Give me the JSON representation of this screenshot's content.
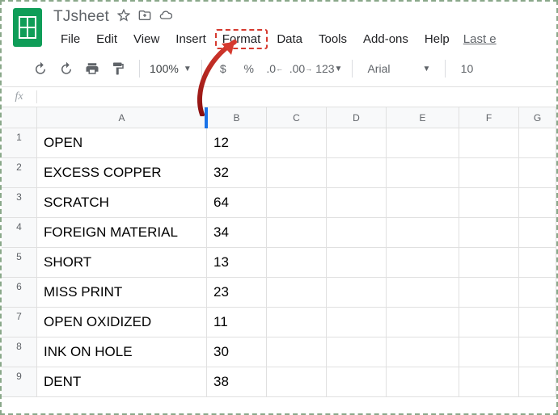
{
  "doc": {
    "title": "TJsheet"
  },
  "menu": {
    "file": "File",
    "edit": "Edit",
    "view": "View",
    "insert": "Insert",
    "format": "Format",
    "data": "Data",
    "tools": "Tools",
    "addons": "Add-ons",
    "help": "Help",
    "last_edit": "Last e"
  },
  "toolbar": {
    "zoom": "100%",
    "currency": "$",
    "percent": "%",
    "dec_dec": ".0",
    "inc_dec": ".00",
    "more_formats": "123",
    "font": "Arial",
    "font_size": "10"
  },
  "fx": {
    "label": "fx"
  },
  "columns": [
    "A",
    "B",
    "C",
    "D",
    "E",
    "F",
    "G"
  ],
  "rows": [
    {
      "n": "1",
      "a": "OPEN",
      "b": "12"
    },
    {
      "n": "2",
      "a": "EXCESS COPPER",
      "b": "32"
    },
    {
      "n": "3",
      "a": "SCRATCH",
      "b": "64"
    },
    {
      "n": "4",
      "a": "FOREIGN MATERIAL",
      "b": "34"
    },
    {
      "n": "5",
      "a": "SHORT",
      "b": "13"
    },
    {
      "n": "6",
      "a": "MISS PRINT",
      "b": "23"
    },
    {
      "n": "7",
      "a": "OPEN OXIDIZED",
      "b": "11"
    },
    {
      "n": "8",
      "a": "INK ON HOLE",
      "b": "30"
    },
    {
      "n": "9",
      "a": "DENT",
      "b": "38"
    }
  ],
  "annotation": {
    "highlight_menu": "format"
  }
}
